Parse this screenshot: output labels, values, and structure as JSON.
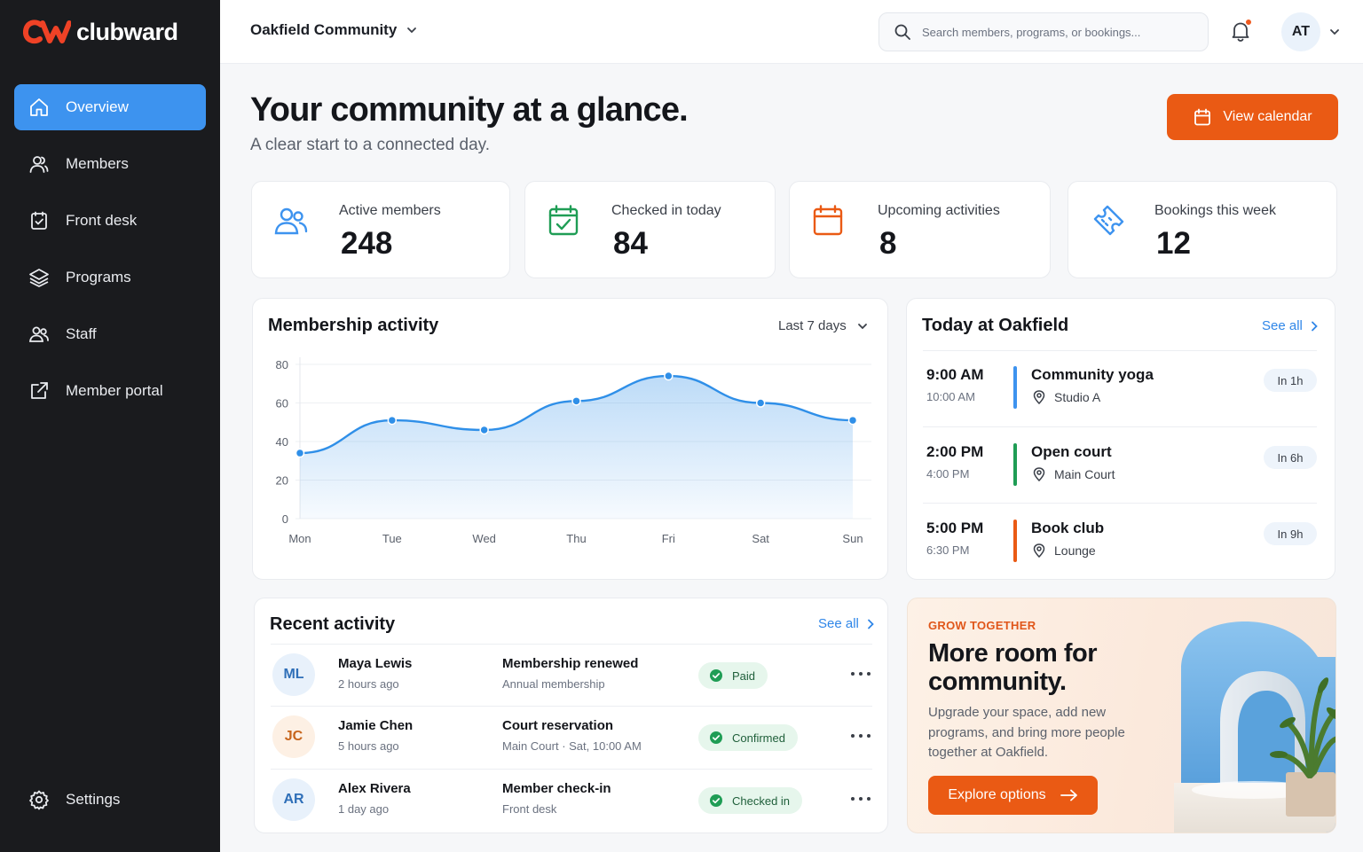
{
  "brand": {
    "name": "clubward",
    "accent": "#ea5a14",
    "primary": "#3d93ef"
  },
  "sidebar": {
    "items": [
      {
        "label": "Overview",
        "icon": "home-icon",
        "active": true
      },
      {
        "label": "Members",
        "icon": "user-icon"
      },
      {
        "label": "Front desk",
        "icon": "clipboard-check-icon"
      },
      {
        "label": "Programs",
        "icon": "layers-icon"
      },
      {
        "label": "Staff",
        "icon": "users-icon"
      },
      {
        "label": "Member portal",
        "icon": "external-link-icon"
      }
    ],
    "settings_label": "Settings"
  },
  "topbar": {
    "community": "Oakfield Community",
    "search_placeholder": "Search members, programs, or bookings...",
    "user_initials": "AT",
    "has_notification": true
  },
  "header": {
    "title": "Your community at a glance.",
    "subtitle": "A clear start to a connected day.",
    "calendar_button": "View calendar"
  },
  "stats": [
    {
      "label": "Active members",
      "value": "248",
      "icon": "users-icon",
      "color": "#3d93ef"
    },
    {
      "label": "Checked in today",
      "value": "84",
      "icon": "calendar-check-icon",
      "color": "#1f9d55"
    },
    {
      "label": "Upcoming activities",
      "value": "8",
      "icon": "calendar-icon",
      "color": "#ea5a14"
    },
    {
      "label": "Bookings this week",
      "value": "12",
      "icon": "ticket-icon",
      "color": "#3d93ef"
    }
  ],
  "membership": {
    "title": "Membership activity",
    "range": "Last 7 days"
  },
  "chart_data": {
    "type": "area",
    "categories": [
      "Mon",
      "Tue",
      "Wed",
      "Thu",
      "Fri",
      "Sat",
      "Sun"
    ],
    "values": [
      34,
      51,
      46,
      61,
      74,
      60,
      51
    ],
    "ylim": [
      0,
      80
    ],
    "yticks": [
      0,
      20,
      40,
      60,
      80
    ],
    "grid": true,
    "color": "#2f8fe8"
  },
  "today": {
    "title": "Today at Oakfield",
    "see_all": "See all",
    "events": [
      {
        "start": "9:00 AM",
        "end": "10:00 AM",
        "name": "Community yoga",
        "location": "Studio A",
        "eta": "In 1h",
        "color": "#3d93ef"
      },
      {
        "start": "2:00 PM",
        "end": "4:00 PM",
        "name": "Open court",
        "location": "Main Court",
        "eta": "In 6h",
        "color": "#1f9d55"
      },
      {
        "start": "5:00 PM",
        "end": "6:30 PM",
        "name": "Book club",
        "location": "Lounge",
        "eta": "In 9h",
        "color": "#ea5a14"
      }
    ]
  },
  "activity": {
    "title": "Recent activity",
    "see_all": "See all",
    "rows": [
      {
        "initials": "ML",
        "name": "Maya Lewis",
        "time": "2 hours ago",
        "action": "Membership renewed",
        "detail": "Annual membership",
        "status": "Paid",
        "avatar_bg": "#e8f1fb",
        "avatar_fg": "#2f6fb8"
      },
      {
        "initials": "JC",
        "name": "Jamie Chen",
        "time": "5 hours ago",
        "action": "Court reservation",
        "detail": "Main Court · Sat, 10:00 AM",
        "status": "Confirmed",
        "avatar_bg": "#fdf0e4",
        "avatar_fg": "#c7651c"
      },
      {
        "initials": "AR",
        "name": "Alex Rivera",
        "time": "1 day ago",
        "action": "Member check-in",
        "detail": "Front desk",
        "status": "Checked in",
        "avatar_bg": "#e8f1fb",
        "avatar_fg": "#2f6fb8"
      }
    ]
  },
  "promo": {
    "eyebrow": "GROW TOGETHER",
    "title": "More room for community.",
    "text": "Upgrade your space, add new programs, and bring more people together at Oakfield.",
    "button": "Explore options"
  }
}
